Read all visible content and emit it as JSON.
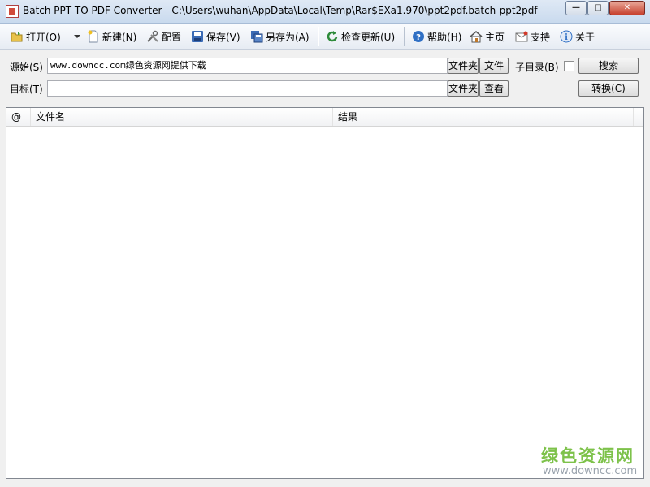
{
  "window": {
    "title": "Batch PPT TO PDF Converter - C:\\Users\\wuhan\\AppData\\Local\\Temp\\Rar$EXa1.970\\ppt2pdf.batch-ppt2pdf",
    "minimize_glyph": "—",
    "maximize_glyph": "□",
    "close_glyph": "✕"
  },
  "toolbar": {
    "open": "打开(O)",
    "new": "新建(N)",
    "config": "配置",
    "save": "保存(V)",
    "save_as": "另存为(A)",
    "check_update": "检查更新(U)",
    "help": "帮助(H)",
    "home": "主页",
    "support": "支持",
    "about": "关于"
  },
  "source": {
    "label": "源始(S)",
    "value": "www.downcc.com绿色资源网提供下载",
    "folder_button": "文件夹",
    "file_button": "文件",
    "subdir_label": "子目录(B)",
    "search_button": "搜索"
  },
  "target": {
    "label": "目标(T)",
    "value": "",
    "folder_button": "文件夹",
    "view_button": "查看",
    "convert_button": "转换(C)"
  },
  "list": {
    "columns": [
      "@",
      "文件名",
      "结果"
    ]
  },
  "watermark": {
    "line1": "绿色资源网",
    "line2": "www.downcc.com"
  },
  "colors": {
    "accent_green": "#7dc24a",
    "title_gradient": "#c9daee"
  }
}
